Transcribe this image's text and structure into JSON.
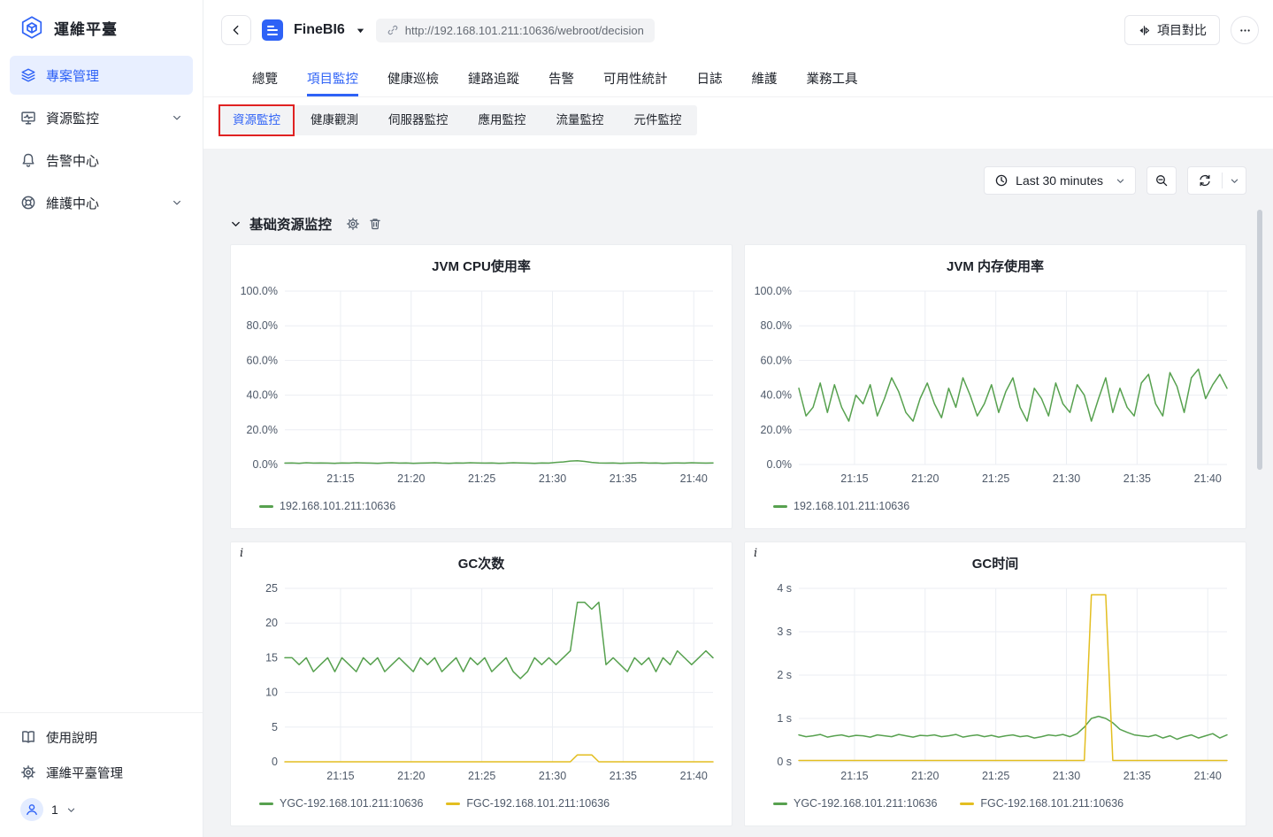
{
  "colors": {
    "accent": "#2e62f6",
    "green": "#57a14f",
    "yellow": "#e3be20",
    "annotation": "#e02222"
  },
  "sidebar": {
    "app_title": "運維平臺",
    "items": [
      {
        "key": "project-management",
        "label": "專案管理",
        "active": true
      },
      {
        "key": "resource-monitor",
        "label": "資源監控",
        "expandable": true
      },
      {
        "key": "alert-center",
        "label": "告警中心"
      },
      {
        "key": "maintenance-center",
        "label": "維護中心",
        "expandable": true
      }
    ],
    "footer_items": [
      {
        "key": "user-guide",
        "label": "使用說明"
      },
      {
        "key": "platform-management",
        "label": "運維平臺管理"
      }
    ],
    "user": {
      "name": "1"
    }
  },
  "header": {
    "project_name": "FineBI6",
    "url": "http://192.168.101.211:10636/webroot/decision",
    "compare_button": "項目對比"
  },
  "tabs": {
    "active_index": 1,
    "items": [
      {
        "key": "overview",
        "label": "總覽"
      },
      {
        "key": "project-monitor",
        "label": "項目監控"
      },
      {
        "key": "health-inspection",
        "label": "健康巡檢"
      },
      {
        "key": "link-trace",
        "label": "鏈路追蹤"
      },
      {
        "key": "alert",
        "label": "告警"
      },
      {
        "key": "availability-stats",
        "label": "可用性統計"
      },
      {
        "key": "logs",
        "label": "日誌"
      },
      {
        "key": "maintenance",
        "label": "維護"
      },
      {
        "key": "business-tools",
        "label": "業務工具"
      }
    ]
  },
  "subtabs": {
    "active_index": 0,
    "items": [
      {
        "key": "resource-monitor",
        "label": "資源監控",
        "annotated": true
      },
      {
        "key": "health-observation",
        "label": "健康觀測"
      },
      {
        "key": "server-monitor",
        "label": "伺服器監控"
      },
      {
        "key": "app-monitor",
        "label": "應用監控"
      },
      {
        "key": "traffic-monitor",
        "label": "流量監控"
      },
      {
        "key": "component-monitor",
        "label": "元件監控"
      }
    ]
  },
  "toolbar": {
    "time_range": "Last 30 minutes"
  },
  "section": {
    "title": "基础资源监控"
  },
  "chart_data": [
    {
      "type": "line",
      "key": "jvm-cpu",
      "title": "JVM CPU使用率",
      "info_icon": false,
      "ylim": [
        0,
        100
      ],
      "y_ticks": [
        {
          "v": 100,
          "label": "100.0%"
        },
        {
          "v": 80,
          "label": "80.0%"
        },
        {
          "v": 60,
          "label": "60.0%"
        },
        {
          "v": 40,
          "label": "40.0%"
        },
        {
          "v": 20,
          "label": "20.0%"
        },
        {
          "v": 0,
          "label": "0.0%"
        }
      ],
      "x_ticks": [
        {
          "pos": 0.13,
          "label": "21:15"
        },
        {
          "pos": 0.295,
          "label": "21:20"
        },
        {
          "pos": 0.46,
          "label": "21:25"
        },
        {
          "pos": 0.625,
          "label": "21:30"
        },
        {
          "pos": 0.79,
          "label": "21:35"
        },
        {
          "pos": 0.955,
          "label": "21:40"
        }
      ],
      "series": [
        {
          "name": "192.168.101.211:10636",
          "color": "#57a14f",
          "values": [
            0.8,
            0.9,
            0.7,
            1,
            0.8,
            0.9,
            0.8,
            0.7,
            0.9,
            0.8,
            1,
            0.9,
            0.8,
            0.7,
            0.9,
            1,
            0.8,
            0.9,
            0.7,
            0.8,
            0.9,
            1,
            0.8,
            0.7,
            0.9,
            0.8,
            1,
            0.9,
            0.8,
            0.9,
            0.7,
            0.8,
            1,
            0.9,
            0.8,
            0.7,
            0.9,
            0.8,
            1.2,
            1.5,
            2,
            2.2,
            1.8,
            1.2,
            0.9,
            0.8,
            0.9,
            0.7,
            0.8,
            0.9,
            1,
            0.8,
            0.9,
            0.7,
            0.8,
            0.9,
            0.8,
            1,
            0.9,
            0.8,
            0.9
          ]
        }
      ]
    },
    {
      "type": "line",
      "key": "jvm-memory",
      "title": "JVM 内存使用率",
      "info_icon": false,
      "ylim": [
        0,
        100
      ],
      "y_ticks": [
        {
          "v": 100,
          "label": "100.0%"
        },
        {
          "v": 80,
          "label": "80.0%"
        },
        {
          "v": 60,
          "label": "60.0%"
        },
        {
          "v": 40,
          "label": "40.0%"
        },
        {
          "v": 20,
          "label": "20.0%"
        },
        {
          "v": 0,
          "label": "0.0%"
        }
      ],
      "x_ticks": [
        {
          "pos": 0.13,
          "label": "21:15"
        },
        {
          "pos": 0.295,
          "label": "21:20"
        },
        {
          "pos": 0.46,
          "label": "21:25"
        },
        {
          "pos": 0.625,
          "label": "21:30"
        },
        {
          "pos": 0.79,
          "label": "21:35"
        },
        {
          "pos": 0.955,
          "label": "21:40"
        }
      ],
      "series": [
        {
          "name": "192.168.101.211:10636",
          "color": "#57a14f",
          "values": [
            44,
            28,
            33,
            47,
            30,
            46,
            33,
            25,
            40,
            35,
            46,
            28,
            38,
            50,
            42,
            30,
            25,
            38,
            47,
            35,
            27,
            44,
            33,
            50,
            40,
            28,
            35,
            46,
            30,
            42,
            50,
            33,
            25,
            44,
            38,
            28,
            47,
            35,
            30,
            46,
            40,
            25,
            38,
            50,
            30,
            44,
            33,
            28,
            47,
            52,
            35,
            28,
            53,
            45,
            30,
            50,
            55,
            38,
            46,
            52,
            44
          ]
        }
      ]
    },
    {
      "type": "line",
      "key": "gc-count",
      "title": "GC次数",
      "info_icon": true,
      "ylim": [
        0,
        25
      ],
      "y_ticks": [
        {
          "v": 25,
          "label": "25"
        },
        {
          "v": 20,
          "label": "20"
        },
        {
          "v": 15,
          "label": "15"
        },
        {
          "v": 10,
          "label": "10"
        },
        {
          "v": 5,
          "label": "5"
        },
        {
          "v": 0,
          "label": "0"
        }
      ],
      "x_ticks": [
        {
          "pos": 0.13,
          "label": "21:15"
        },
        {
          "pos": 0.295,
          "label": "21:20"
        },
        {
          "pos": 0.46,
          "label": "21:25"
        },
        {
          "pos": 0.625,
          "label": "21:30"
        },
        {
          "pos": 0.79,
          "label": "21:35"
        },
        {
          "pos": 0.955,
          "label": "21:40"
        }
      ],
      "series": [
        {
          "name": "YGC-192.168.101.211:10636",
          "color": "#57a14f",
          "values": [
            15,
            15,
            14,
            15,
            13,
            14,
            15,
            13,
            15,
            14,
            13,
            15,
            14,
            15,
            13,
            14,
            15,
            14,
            13,
            15,
            14,
            15,
            13,
            14,
            15,
            13,
            15,
            14,
            15,
            13,
            14,
            15,
            13,
            12,
            13,
            15,
            14,
            15,
            14,
            15,
            16,
            23,
            23,
            22,
            23,
            14,
            15,
            14,
            13,
            15,
            14,
            15,
            13,
            15,
            14,
            16,
            15,
            14,
            15,
            16,
            15
          ]
        },
        {
          "name": "FGC-192.168.101.211:10636",
          "color": "#e3be20",
          "values": [
            0,
            0,
            0,
            0,
            0,
            0,
            0,
            0,
            0,
            0,
            0,
            0,
            0,
            0,
            0,
            0,
            0,
            0,
            0,
            0,
            0,
            0,
            0,
            0,
            0,
            0,
            0,
            0,
            0,
            0,
            0,
            0,
            0,
            0,
            0,
            0,
            0,
            0,
            0,
            0,
            0,
            1,
            1,
            1,
            0,
            0,
            0,
            0,
            0,
            0,
            0,
            0,
            0,
            0,
            0,
            0,
            0,
            0,
            0,
            0,
            0
          ]
        }
      ]
    },
    {
      "type": "line",
      "key": "gc-time",
      "title": "GC时间",
      "info_icon": true,
      "ylim": [
        0,
        4
      ],
      "y_ticks": [
        {
          "v": 4,
          "label": "4 s"
        },
        {
          "v": 3,
          "label": "3 s"
        },
        {
          "v": 2,
          "label": "2 s"
        },
        {
          "v": 1,
          "label": "1 s"
        },
        {
          "v": 0,
          "label": "0 s"
        }
      ],
      "x_ticks": [
        {
          "pos": 0.13,
          "label": "21:15"
        },
        {
          "pos": 0.295,
          "label": "21:20"
        },
        {
          "pos": 0.46,
          "label": "21:25"
        },
        {
          "pos": 0.625,
          "label": "21:30"
        },
        {
          "pos": 0.79,
          "label": "21:35"
        },
        {
          "pos": 0.955,
          "label": "21:40"
        }
      ],
      "series": [
        {
          "name": "YGC-192.168.101.211:10636",
          "color": "#57a14f",
          "values": [
            0.62,
            0.58,
            0.6,
            0.63,
            0.57,
            0.6,
            0.62,
            0.58,
            0.61,
            0.6,
            0.57,
            0.62,
            0.6,
            0.58,
            0.63,
            0.6,
            0.57,
            0.61,
            0.6,
            0.62,
            0.58,
            0.6,
            0.63,
            0.57,
            0.6,
            0.62,
            0.58,
            0.61,
            0.57,
            0.6,
            0.62,
            0.58,
            0.6,
            0.55,
            0.58,
            0.62,
            0.6,
            0.63,
            0.58,
            0.65,
            0.8,
            1,
            1.05,
            1,
            0.9,
            0.75,
            0.68,
            0.62,
            0.6,
            0.58,
            0.62,
            0.55,
            0.6,
            0.52,
            0.58,
            0.62,
            0.55,
            0.6,
            0.65,
            0.55,
            0.62
          ]
        },
        {
          "name": "FGC-192.168.101.211:10636",
          "color": "#e3be20",
          "values": [
            0.03,
            0.03,
            0.03,
            0.03,
            0.03,
            0.03,
            0.03,
            0.03,
            0.03,
            0.03,
            0.03,
            0.03,
            0.03,
            0.03,
            0.03,
            0.03,
            0.03,
            0.03,
            0.03,
            0.03,
            0.03,
            0.03,
            0.03,
            0.03,
            0.03,
            0.03,
            0.03,
            0.03,
            0.03,
            0.03,
            0.03,
            0.03,
            0.03,
            0.03,
            0.03,
            0.03,
            0.03,
            0.03,
            0.03,
            0.03,
            0.03,
            3.85,
            3.85,
            3.85,
            0.03,
            0.03,
            0.03,
            0.03,
            0.03,
            0.03,
            0.03,
            0.03,
            0.03,
            0.03,
            0.03,
            0.03,
            0.03,
            0.03,
            0.03,
            0.03,
            0.03
          ]
        }
      ]
    }
  ]
}
